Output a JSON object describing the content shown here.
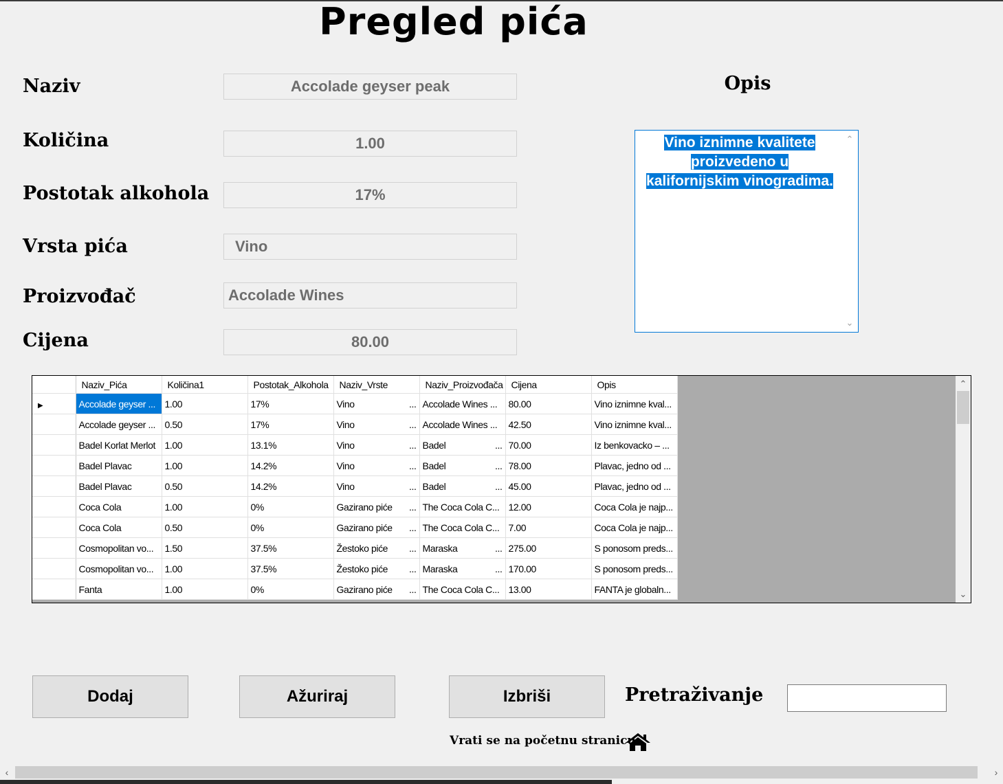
{
  "title": "Pregled pića",
  "labels": {
    "naziv": "Naziv",
    "kolicina": "Količina",
    "postotak": "Postotak alkohola",
    "vrsta": "Vrsta pića",
    "proizvodac": "Proizvođač",
    "cijena": "Cijena",
    "opis": "Opis"
  },
  "fields": {
    "naziv": "Accolade geyser peak",
    "kolicina": "1.00",
    "postotak": "17%",
    "vrsta": "Vino",
    "proizvodac": "Accolade Wines",
    "cijena": "80.00"
  },
  "opis_lines": [
    "Vino iznimne kvalitete",
    "proizvedeno u",
    "kalifornijskim vinogradima."
  ],
  "grid": {
    "columns": [
      "Naziv_Pića",
      "Količina1",
      "Postotak_Alkohola",
      "Naziv_Vrste",
      "Naziv_Proizvođača",
      "Cijena",
      "Opis"
    ],
    "rows": [
      [
        "Accolade geyser ...",
        "1.00",
        "17%",
        "Vino",
        "Accolade Wines ...",
        "80.00",
        "Vino iznimne kval..."
      ],
      [
        "Accolade geyser ...",
        "0.50",
        "17%",
        "Vino",
        "Accolade Wines ...",
        "42.50",
        "Vino iznimne kval..."
      ],
      [
        "Badel Korlat Merlot",
        "1.00",
        "13.1%",
        "Vino",
        "Badel",
        "70.00",
        "Iz benkovacko – ..."
      ],
      [
        "Badel Plavac",
        "1.00",
        "14.2%",
        "Vino",
        "Badel",
        "78.00",
        "Plavac, jedno od ..."
      ],
      [
        "Badel Plavac",
        "0.50",
        "14.2%",
        "Vino",
        "Badel",
        "45.00",
        "Plavac, jedno od ..."
      ],
      [
        "Coca Cola",
        "1.00",
        "0%",
        "Gazirano piće",
        "The Coca Cola C...",
        "12.00",
        "Coca Cola je najp..."
      ],
      [
        "Coca Cola",
        "0.50",
        "0%",
        "Gazirano piće",
        "The Coca Cola C...",
        "7.00",
        "Coca Cola je najp..."
      ],
      [
        "Cosmopolitan vo...",
        "1.50",
        "37.5%",
        "Žestoko piće",
        "Maraska",
        "275.00",
        "S ponosom preds..."
      ],
      [
        "Cosmopolitan vo...",
        "1.00",
        "37.5%",
        "Žestoko piće",
        "Maraska",
        "170.00",
        "S ponosom preds..."
      ],
      [
        "Fanta",
        "1.00",
        "0%",
        "Gazirano piće",
        "The Coca Cola C...",
        "13.00",
        "FANTA je globaln..."
      ]
    ],
    "combo_suffix": "...",
    "current_row_marker": "▶"
  },
  "buttons": {
    "dodaj": "Dodaj",
    "azuriraj": "Ažuriraj",
    "izbrisi": "Izbriši"
  },
  "search": {
    "label": "Pretraživanje",
    "value": ""
  },
  "home_link": "Vrati se na početnu stranicu",
  "icons": {
    "home": "home-icon",
    "scroll_up": "chevron-up-icon",
    "scroll_down": "chevron-down-icon",
    "row_pointer": "row-pointer-icon"
  },
  "colors": {
    "selection": "#0078d7",
    "background": "#f0f0f0",
    "grid_empty": "#ababab"
  }
}
